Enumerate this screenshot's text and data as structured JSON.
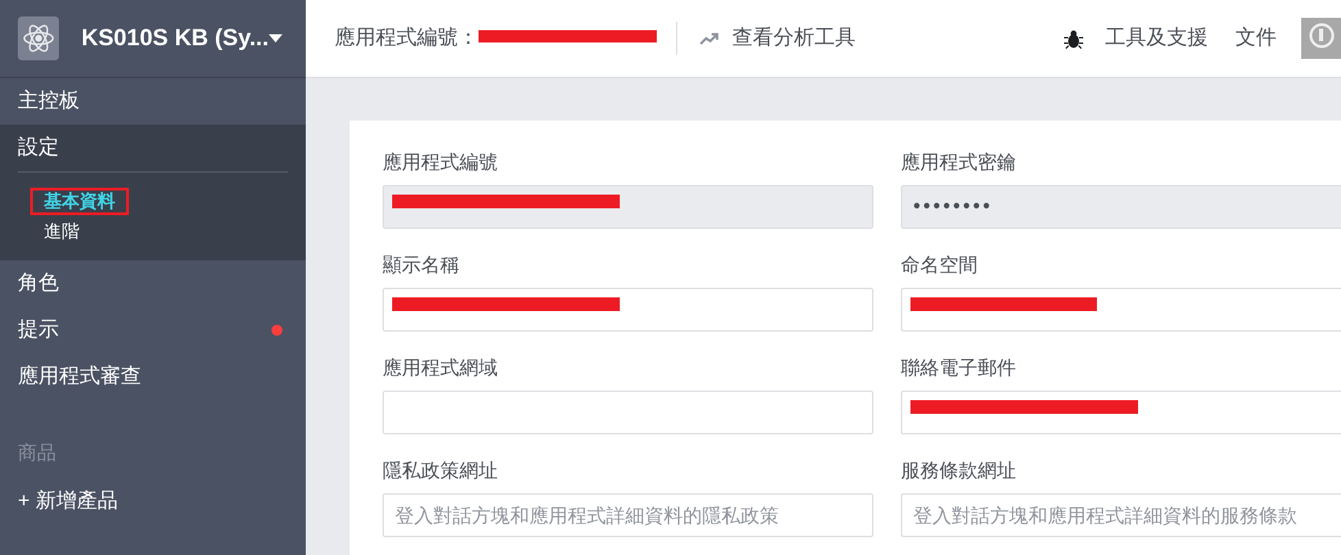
{
  "app": {
    "name": "KS010S KB (Sy..."
  },
  "sidebar": {
    "items": [
      {
        "label": "主控板",
        "selected": false
      },
      {
        "label": "設定",
        "selected": true,
        "children": [
          {
            "label": "基本資料",
            "selected": true,
            "highlighted": true
          },
          {
            "label": "進階",
            "selected": false,
            "highlighted": false
          }
        ]
      },
      {
        "label": "角色",
        "selected": false
      },
      {
        "label": "提示",
        "selected": false,
        "alert": true
      },
      {
        "label": "應用程式審查",
        "selected": false
      }
    ],
    "section": "商品",
    "add_product": "+ 新增產品"
  },
  "top_bar": {
    "app_id_label": "應用程式編號：",
    "app_id_redacted": true,
    "analytics": "查看分析工具",
    "support": "工具及支援",
    "docs": "文件"
  },
  "form": {
    "fields": [
      {
        "label": "應用程式編號",
        "kind": "readonly",
        "redacted": true
      },
      {
        "label": "應用程式密鑰",
        "kind": "secret",
        "value": "••••••••"
      },
      {
        "label": "顯示名稱",
        "kind": "text",
        "redacted": true
      },
      {
        "label": "命名空間",
        "kind": "text",
        "redacted": true
      },
      {
        "label": "應用程式網域",
        "kind": "text"
      },
      {
        "label": "聯絡電子郵件",
        "kind": "text",
        "redacted": true
      },
      {
        "label": "隱私政策網址",
        "kind": "text",
        "placeholder": "登入對話方塊和應用程式詳細資料的隱私政策"
      },
      {
        "label": "服務條款網址",
        "kind": "text",
        "placeholder": "登入對話方塊和應用程式詳細資料的服務條款"
      }
    ]
  }
}
